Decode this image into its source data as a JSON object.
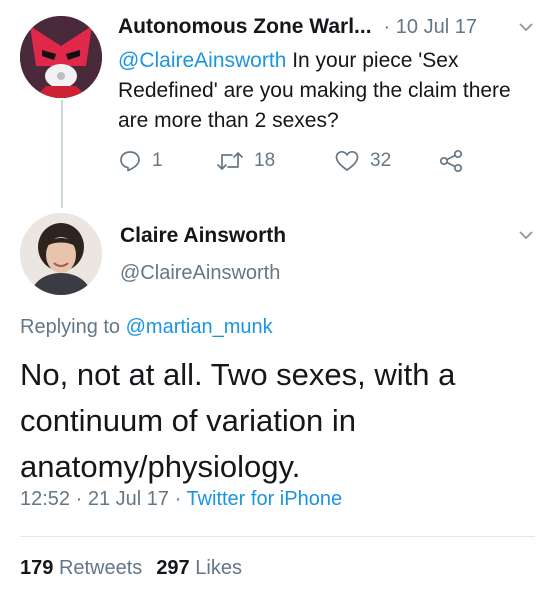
{
  "reply_tweet": {
    "author_name": "Autonomous Zone Warl...",
    "date": "· 10 Jul 17",
    "mention": "@ClaireAinsworth",
    "text": " In your piece 'Sex Redefined' are you making the claim there are more than 2 sexes?",
    "actions": {
      "reply_count": "1",
      "retweet_count": "18",
      "like_count": "32"
    },
    "icons": [
      "reply-icon",
      "retweet-icon",
      "like-icon",
      "share-icon",
      "chevron-down-icon"
    ]
  },
  "main_tweet": {
    "author_name": "Claire Ainsworth",
    "handle": "@ClaireAinsworth",
    "replying_prefix": "Replying to ",
    "replying_to": "@martian_munk",
    "text": "No, not at all. Two sexes, with a continuum of variation in anatomy/physiology.",
    "time": "12:52",
    "date": "21 Jul 17",
    "source": "Twitter for iPhone",
    "retweets_count": "179",
    "retweets_label": "Retweets",
    "likes_count": "297",
    "likes_label": "Likes"
  },
  "colors": {
    "link": "#1b95e0",
    "secondary_text": "#657786",
    "primary_text": "#14171a",
    "divider": "#e1e8ed"
  }
}
